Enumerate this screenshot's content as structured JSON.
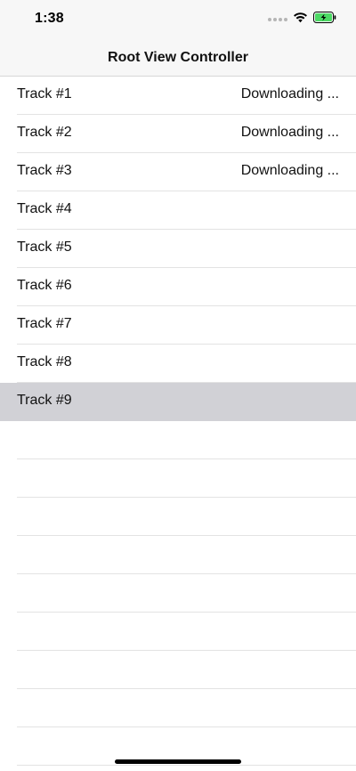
{
  "status_bar": {
    "time": "1:38",
    "icons": [
      "signal-dots-icon",
      "wifi-icon",
      "battery-charging-icon"
    ],
    "battery_color": "#4cd964"
  },
  "nav": {
    "title": "Root View Controller"
  },
  "tracks": [
    {
      "title": "Track #1",
      "detail": "Downloading ..."
    },
    {
      "title": "Track #2",
      "detail": "Downloading ..."
    },
    {
      "title": "Track #3",
      "detail": "Downloading ..."
    },
    {
      "title": "Track #4",
      "detail": ""
    },
    {
      "title": "Track #5",
      "detail": ""
    },
    {
      "title": "Track #6",
      "detail": ""
    },
    {
      "title": "Track #7",
      "detail": ""
    },
    {
      "title": "Track #8",
      "detail": ""
    },
    {
      "title": "Track #9",
      "detail": "",
      "selected": true
    }
  ],
  "colors": {
    "selection": "#d1d1d6",
    "bar_background": "#f7f7f7",
    "separator": "#e3e3e3"
  }
}
